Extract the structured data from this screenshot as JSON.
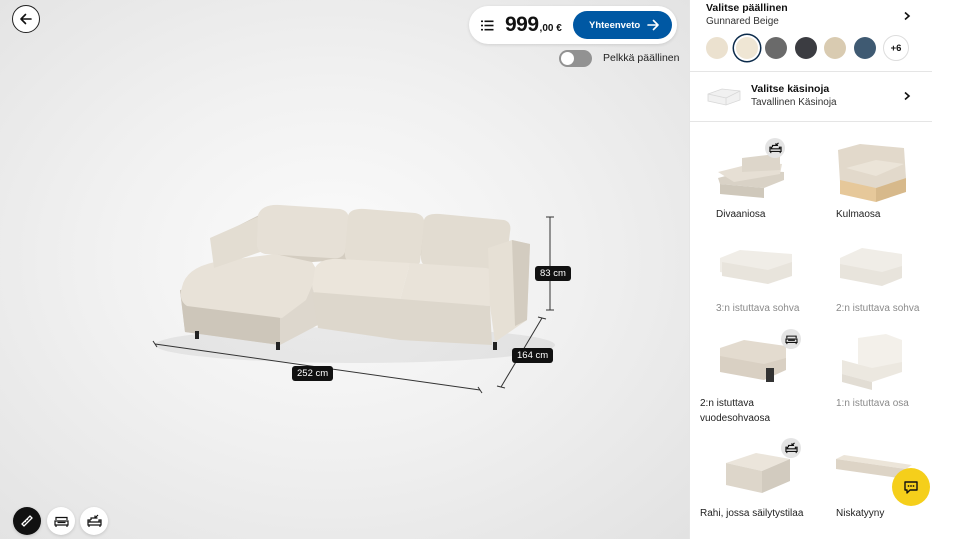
{
  "viewer": {
    "price_integer": "999",
    "price_decimal": ",00 €",
    "summary_button": "Yhteenveto",
    "toggle_label": "Pelkkä päällinen",
    "toggle_on": false,
    "dimensions": {
      "width": "252 cm",
      "depth": "164 cm",
      "height": "83 cm"
    },
    "tools": [
      {
        "name": "ruler-icon",
        "active": true
      },
      {
        "name": "sofa-bed-icon",
        "active": false
      },
      {
        "name": "sofa-storage-icon",
        "active": false
      }
    ]
  },
  "cover": {
    "title": "Valitse päällinen",
    "value": "Gunnared Beige",
    "swatches": [
      "#ebe1cf",
      "#efe6d4",
      "#6a6a6a",
      "#3b3c41",
      "#d9cbb1",
      "#3f5a72"
    ],
    "selected_index": 1,
    "more_label": "+6"
  },
  "armrest": {
    "title": "Valitse käsinoja",
    "value": "Tavallinen Käsinoja"
  },
  "modules": [
    {
      "label": "Divaaniosa",
      "enabled": true,
      "badge": "sofa-storage-icon"
    },
    {
      "label": "Kulmaosa",
      "enabled": true,
      "badge": ""
    },
    {
      "label": "3:n istuttava sohva",
      "enabled": false,
      "badge": ""
    },
    {
      "label": "2:n istuttava sohva",
      "enabled": false,
      "badge": ""
    },
    {
      "label": "2:n istuttava",
      "label2": "vuodesohvaosa",
      "enabled": true,
      "badge": "sofa-bed-icon"
    },
    {
      "label": "1:n istuttava osa",
      "enabled": false,
      "badge": ""
    },
    {
      "label": "Rahi, jossa säilytystilaa",
      "enabled": true,
      "badge": "sofa-storage-icon"
    },
    {
      "label": "Niskatyyny",
      "enabled": true,
      "badge": ""
    }
  ],
  "colors": {
    "accent": "#0058a3",
    "chat": "#f5cf1b"
  }
}
